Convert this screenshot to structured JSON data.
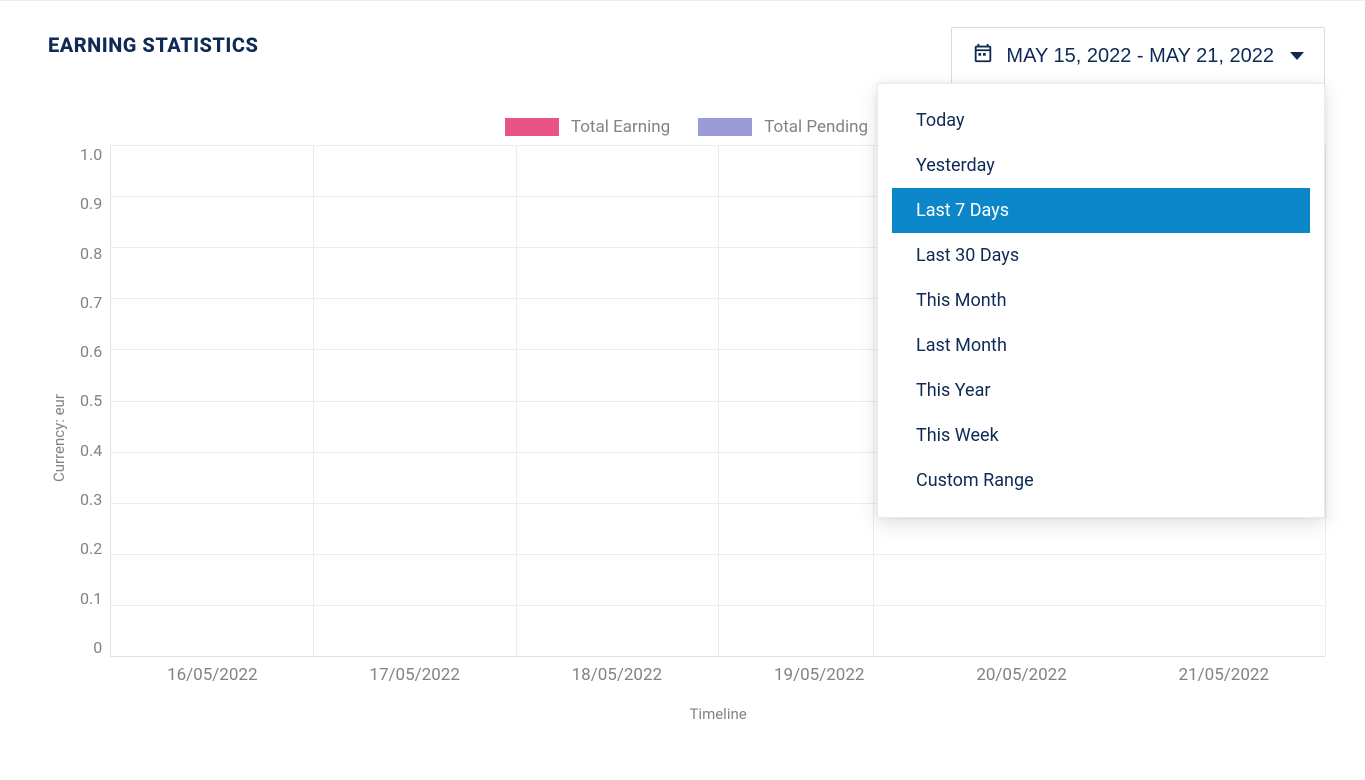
{
  "header": {
    "title": "EARNING STATISTICS"
  },
  "date_range": {
    "display": "MAY 15, 2022 - MAY 21, 2022",
    "options": [
      "Today",
      "Yesterday",
      "Last 7 Days",
      "Last 30 Days",
      "This Month",
      "Last Month",
      "This Year",
      "This Week",
      "Custom Range"
    ],
    "selected_index": 2
  },
  "legend": {
    "series1": "Total Earning",
    "series2": "Total Pending"
  },
  "axes": {
    "ylabel": "Currency: eur",
    "xlabel": "Timeline",
    "y_ticks": [
      "1.0",
      "0.9",
      "0.8",
      "0.7",
      "0.6",
      "0.5",
      "0.4",
      "0.3",
      "0.2",
      "0.1",
      "0"
    ],
    "x_ticks": [
      "16/05/2022",
      "17/05/2022",
      "18/05/2022",
      "19/05/2022",
      "20/05/2022",
      "21/05/2022"
    ]
  },
  "chart_data": {
    "type": "bar",
    "title": "EARNING STATISTICS",
    "xlabel": "Timeline",
    "ylabel": "Currency: eur",
    "ylim": [
      0,
      1.0
    ],
    "categories": [
      "16/05/2022",
      "17/05/2022",
      "18/05/2022",
      "19/05/2022",
      "20/05/2022",
      "21/05/2022"
    ],
    "series": [
      {
        "name": "Total Earning",
        "color": "#e8467c",
        "values": [
          0,
          0,
          0,
          0,
          0,
          0
        ]
      },
      {
        "name": "Total Pending",
        "color": "#8a8ad2",
        "values": [
          0,
          0,
          0,
          0,
          0,
          0
        ]
      }
    ]
  }
}
